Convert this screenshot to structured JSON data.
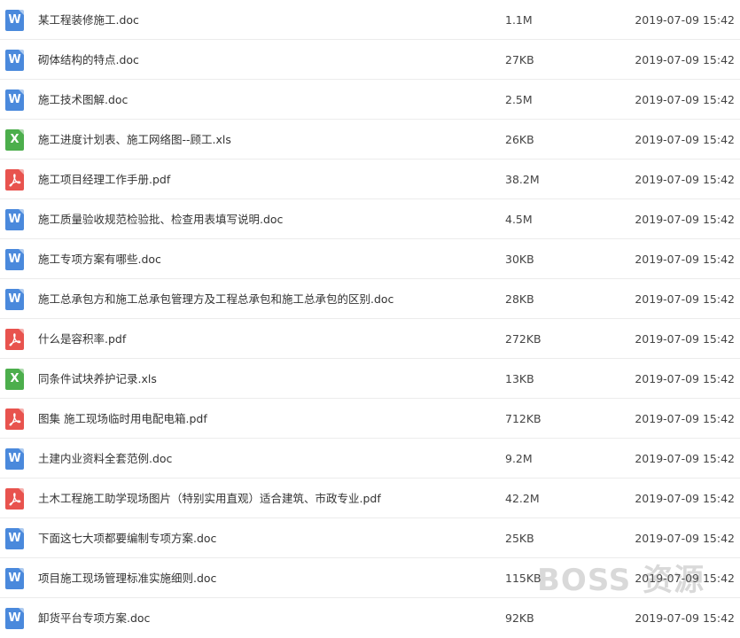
{
  "files": [
    {
      "name": "某工程装修施工.doc",
      "size": "1.1M",
      "date": "2019-07-09 15:42",
      "type": "doc",
      "icon": "word-doc-icon",
      "glyph": "W"
    },
    {
      "name": "砌体结构的特点.doc",
      "size": "27KB",
      "date": "2019-07-09 15:42",
      "type": "doc",
      "icon": "word-doc-icon",
      "glyph": "W"
    },
    {
      "name": "施工技术图解.doc",
      "size": "2.5M",
      "date": "2019-07-09 15:42",
      "type": "doc",
      "icon": "word-doc-icon",
      "glyph": "W"
    },
    {
      "name": "施工进度计划表、施工网络图--顾工.xls",
      "size": "26KB",
      "date": "2019-07-09 15:42",
      "type": "xls",
      "icon": "excel-xls-icon",
      "glyph": "X"
    },
    {
      "name": "施工项目经理工作手册.pdf",
      "size": "38.2M",
      "date": "2019-07-09 15:42",
      "type": "pdf",
      "icon": "pdf-file-icon",
      "glyph": ""
    },
    {
      "name": "施工质量验收规范检验批、检查用表填写说明.doc",
      "size": "4.5M",
      "date": "2019-07-09 15:42",
      "type": "doc",
      "icon": "word-doc-icon",
      "glyph": "W"
    },
    {
      "name": "施工专项方案有哪些.doc",
      "size": "30KB",
      "date": "2019-07-09 15:42",
      "type": "doc",
      "icon": "word-doc-icon",
      "glyph": "W"
    },
    {
      "name": "施工总承包方和施工总承包管理方及工程总承包和施工总承包的区别.doc",
      "size": "28KB",
      "date": "2019-07-09 15:42",
      "type": "doc",
      "icon": "word-doc-icon",
      "glyph": "W"
    },
    {
      "name": "什么是容积率.pdf",
      "size": "272KB",
      "date": "2019-07-09 15:42",
      "type": "pdf",
      "icon": "pdf-file-icon",
      "glyph": ""
    },
    {
      "name": "同条件试块养护记录.xls",
      "size": "13KB",
      "date": "2019-07-09 15:42",
      "type": "xls",
      "icon": "excel-xls-icon",
      "glyph": "X"
    },
    {
      "name": "图集 施工现场临时用电配电箱.pdf",
      "size": "712KB",
      "date": "2019-07-09 15:42",
      "type": "pdf",
      "icon": "pdf-file-icon",
      "glyph": ""
    },
    {
      "name": "土建内业资料全套范例.doc",
      "size": "9.2M",
      "date": "2019-07-09 15:42",
      "type": "doc",
      "icon": "word-doc-icon",
      "glyph": "W"
    },
    {
      "name": "土木工程施工助学现场图片（特别实用直观）适合建筑、市政专业.pdf",
      "size": "42.2M",
      "date": "2019-07-09 15:42",
      "type": "pdf",
      "icon": "pdf-file-icon",
      "glyph": ""
    },
    {
      "name": "下面这七大项都要编制专项方案.doc",
      "size": "25KB",
      "date": "2019-07-09 15:42",
      "type": "doc",
      "icon": "word-doc-icon",
      "glyph": "W"
    },
    {
      "name": "项目施工现场管理标准实施细则.doc",
      "size": "115KB",
      "date": "2019-07-09 15:42",
      "type": "doc",
      "icon": "word-doc-icon",
      "glyph": "W"
    },
    {
      "name": "卸货平台专项方案.doc",
      "size": "92KB",
      "date": "2019-07-09 15:42",
      "type": "doc",
      "icon": "word-doc-icon",
      "glyph": "W"
    }
  ],
  "watermark": "BOSS 资源",
  "colors": {
    "doc": "#4a89dc",
    "xls": "#4cae4c",
    "pdf": "#e8534e",
    "divider": "#ececec",
    "text": "#333333"
  }
}
